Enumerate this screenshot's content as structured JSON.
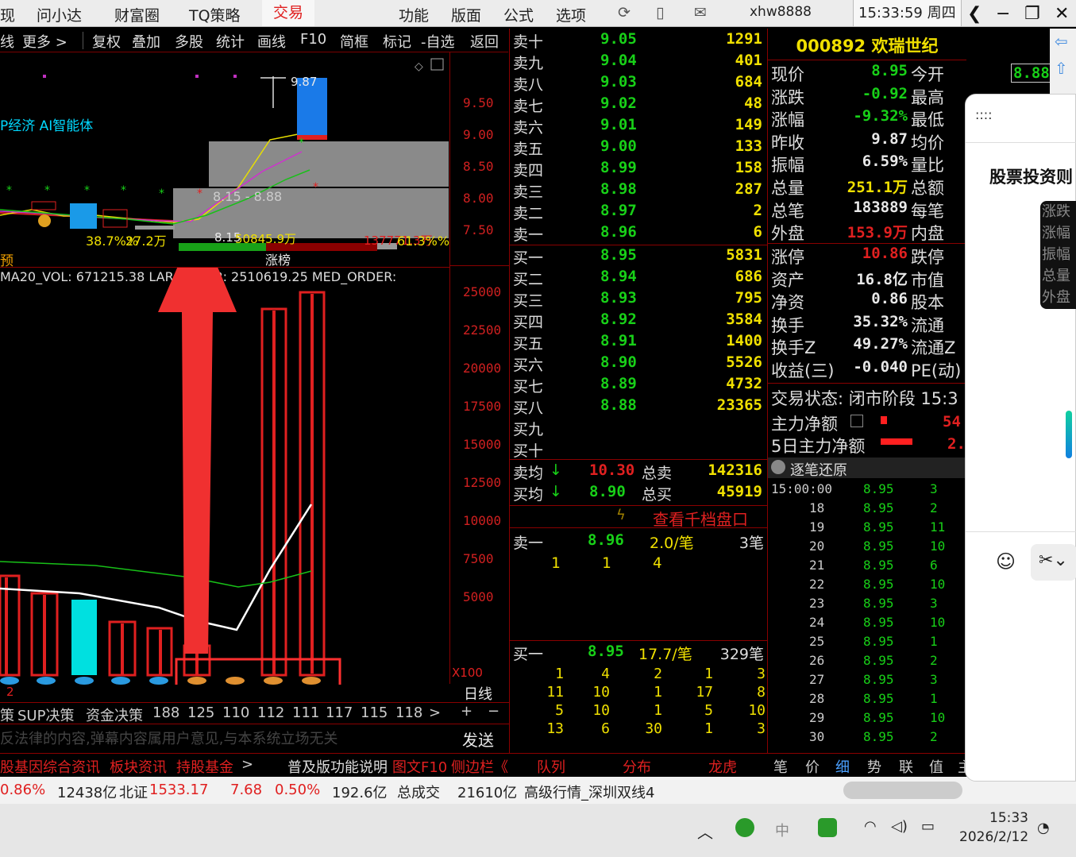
{
  "topbar": {
    "left_cut": "现",
    "tabs": [
      "问小达",
      "财富圈",
      "TQ策略",
      "交易"
    ],
    "menus": [
      "功能",
      "版面",
      "公式",
      "选项"
    ],
    "user": "xhw8888",
    "clock": "15:33:59 周四"
  },
  "toolbar": {
    "items": [
      "线",
      "更多 >",
      "复权",
      "叠加",
      "多股",
      "统计",
      "画线",
      "F10",
      "简框",
      "标记",
      "-自选",
      "返回"
    ]
  },
  "kline": {
    "ai_label": "P经济 AI智能体",
    "high_label": "9.87",
    "range_label": "8.15 - 8.88",
    "bottom_labels": [
      "38.7%%",
      "27.2万",
      "8.15",
      "50845.9万",
      "137771.3万",
      "61.3%%"
    ],
    "yu_label": "预",
    "zhangbang_label": "涨榜",
    "price_ticks": [
      "9.50",
      "9.00",
      "8.50",
      "8.00",
      "7.50"
    ]
  },
  "volume": {
    "header": "MA20_VOL: 671215.38  LAR     ORDER: 2510619.25  MED_ORDER:",
    "ticks": [
      "25000",
      "22500",
      "20000",
      "17500",
      "15000",
      "12500",
      "10000",
      "7500",
      "5000"
    ],
    "unit": "X100",
    "period": "日线",
    "x_label": "2"
  },
  "bottom_tabs": [
    "策",
    "SUP决策",
    "资金决策",
    "188",
    "125",
    "110",
    "112",
    "111",
    "117",
    "115",
    "118",
    ">",
    "+",
    "−"
  ],
  "disclaimer": "反法律的内容,弹幕内容属用户意见,与本系统立场无关",
  "send_label": "发送",
  "orderbook": {
    "sell": [
      {
        "label": "卖十",
        "price": "9.05",
        "vol": "1291"
      },
      {
        "label": "卖九",
        "price": "9.04",
        "vol": "401"
      },
      {
        "label": "卖八",
        "price": "9.03",
        "vol": "684"
      },
      {
        "label": "卖七",
        "price": "9.02",
        "vol": "48"
      },
      {
        "label": "卖六",
        "price": "9.01",
        "vol": "149"
      },
      {
        "label": "卖五",
        "price": "9.00",
        "vol": "133"
      },
      {
        "label": "卖四",
        "price": "8.99",
        "vol": "158"
      },
      {
        "label": "卖三",
        "price": "8.98",
        "vol": "287"
      },
      {
        "label": "卖二",
        "price": "8.97",
        "vol": "2"
      },
      {
        "label": "卖一",
        "price": "8.96",
        "vol": "6"
      }
    ],
    "buy": [
      {
        "label": "买一",
        "price": "8.95",
        "vol": "5831"
      },
      {
        "label": "买二",
        "price": "8.94",
        "vol": "686"
      },
      {
        "label": "买三",
        "price": "8.93",
        "vol": "795"
      },
      {
        "label": "买四",
        "price": "8.92",
        "vol": "3584"
      },
      {
        "label": "买五",
        "price": "8.91",
        "vol": "1400"
      },
      {
        "label": "买六",
        "price": "8.90",
        "vol": "5526"
      },
      {
        "label": "买七",
        "price": "8.89",
        "vol": "4732"
      },
      {
        "label": "买八",
        "price": "8.88",
        "vol": "23365"
      },
      {
        "label": "买九",
        "price": "",
        "vol": ""
      },
      {
        "label": "买十",
        "price": "",
        "vol": ""
      }
    ],
    "sell_avg": {
      "label": "卖均",
      "price": "10.30",
      "total_label": "总卖",
      "total": "142316"
    },
    "buy_avg": {
      "label": "买均",
      "price": "8.90",
      "total_label": "总买",
      "total": "45919"
    },
    "depth_link": "查看千档盘口",
    "queue_sell": {
      "label": "卖一",
      "price": "8.96",
      "per": "2.0/笔",
      "count": "3笔",
      "items": [
        "1",
        "1",
        "4"
      ]
    },
    "queue_buy": {
      "label": "买一",
      "price": "8.95",
      "per": "17.7/笔",
      "count": "329笔",
      "rows": [
        [
          "1",
          "4",
          "2",
          "1",
          "3"
        ],
        [
          "11",
          "10",
          "1",
          "17",
          "8"
        ],
        [
          "5",
          "10",
          "1",
          "5",
          "10"
        ],
        [
          "13",
          "6",
          "30",
          "1",
          "3"
        ]
      ]
    },
    "tabs": [
      "队列",
      "分布",
      "龙虎"
    ]
  },
  "info": {
    "code_name": "000892 欢瑞世纪",
    "rows": [
      {
        "k": "现价",
        "v": "8.95",
        "k2": "今开",
        "c": "#18d018"
      },
      {
        "k": "涨跌",
        "v": "-0.92",
        "k2": "最高",
        "c": "#18d018"
      },
      {
        "k": "涨幅",
        "v": "-9.32%",
        "k2": "最低",
        "c": "#18d018"
      },
      {
        "k": "昨收",
        "v": "9.87",
        "k2": "均价",
        "c": "#e8e8e8"
      },
      {
        "k": "振幅",
        "v": "6.59%",
        "k2": "量比",
        "c": "#e8e8e8"
      },
      {
        "k": "总量",
        "v": "251.1万",
        "k2": "总额",
        "c": "#f0e000"
      },
      {
        "k": "总笔",
        "v": "183889",
        "k2": "每笔",
        "c": "#e8e8e8"
      },
      {
        "k": "外盘",
        "v": "153.9万",
        "k2": "内盘",
        "c": "#e02020"
      },
      {
        "k": "涨停",
        "v": "10.86",
        "k2": "跌停",
        "c": "#e02020"
      },
      {
        "k": "资产",
        "v": "16.8亿",
        "k2": "市值",
        "c": "#e8e8e8"
      },
      {
        "k": "净资",
        "v": "0.86",
        "k2": "股本",
        "c": "#e8e8e8"
      },
      {
        "k": "换手",
        "v": "35.32%",
        "k2": "流通",
        "c": "#e8e8e8"
      },
      {
        "k": "换手Z",
        "v": "49.27%",
        "k2": "流通Z",
        "c": "#e8e8e8"
      },
      {
        "k": "收益(三)",
        "v": "-0.040",
        "k2": "PE(动)",
        "c": "#e8e8e8"
      }
    ],
    "open_val": "8.88",
    "trade_status": "交易状态: 闭市阶段 15:3",
    "main_net": "主力净额",
    "main_net_val": "54",
    "main_net5": "5日主力净额",
    "main_net5_val": "2.",
    "tick_header": "逐笔还原",
    "ticks": [
      {
        "t": "15:00:00",
        "p": "8.95",
        "n": "3"
      },
      {
        "t": "18",
        "p": "8.95",
        "n": "2"
      },
      {
        "t": "19",
        "p": "8.95",
        "n": "11"
      },
      {
        "t": "20",
        "p": "8.95",
        "n": "10"
      },
      {
        "t": "21",
        "p": "8.95",
        "n": "6"
      },
      {
        "t": "22",
        "p": "8.95",
        "n": "10"
      },
      {
        "t": "23",
        "p": "8.95",
        "n": "3"
      },
      {
        "t": "24",
        "p": "8.95",
        "n": "10"
      },
      {
        "t": "25",
        "p": "8.95",
        "n": "1"
      },
      {
        "t": "26",
        "p": "8.95",
        "n": "2"
      },
      {
        "t": "27",
        "p": "8.95",
        "n": "3"
      },
      {
        "t": "28",
        "p": "8.95",
        "n": "1"
      },
      {
        "t": "29",
        "p": "8.95",
        "n": "10"
      },
      {
        "t": "30",
        "p": "8.95",
        "n": "2"
      }
    ],
    "tabs": [
      "笔",
      "价",
      "细",
      "势",
      "联",
      "值",
      "主"
    ]
  },
  "bottombar": {
    "items": [
      "股基因",
      "综合资讯",
      "板块资讯",
      "持股基金",
      ">",
      "普及版功能说明",
      "图文F10",
      "侧边栏《"
    ]
  },
  "statusbar": {
    "a": "0.86%",
    "b": "12438亿",
    "c": "北证",
    "d": "1533.17",
    "e": "7.68",
    "f": "0.50%",
    "g": "192.6亿",
    "h": "总成交",
    "i": "21610亿",
    "j": "高级行情_深圳双线4"
  },
  "taskbar": {
    "time": "15:33",
    "date": "2026/2/12",
    "ime": "中"
  },
  "popup": {
    "title": "股票投资则",
    "menu_dots": "::::",
    "side_items": [
      "涨跌",
      "涨幅",
      "振幅",
      "总量",
      "外盘"
    ]
  },
  "colors": {
    "up": "#e02020",
    "down": "#18d018",
    "accent": "#f0e000",
    "bg": "#000000",
    "arrow": "#f03030"
  }
}
